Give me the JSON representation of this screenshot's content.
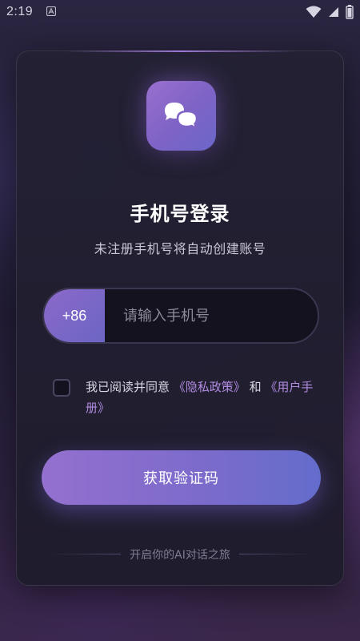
{
  "status_bar": {
    "time": "2:19",
    "icons": [
      "app-notification-icon",
      "wifi-icon",
      "signal-icon",
      "battery-icon"
    ]
  },
  "login": {
    "app_icon": "chat-bubbles-icon",
    "title": "手机号登录",
    "subtitle": "未注册手机号将自动创建账号",
    "phone": {
      "country_code": "+86",
      "value": "",
      "placeholder": "请输入手机号"
    },
    "agreement": {
      "checked": false,
      "prefix": "我已阅读并同意",
      "privacy_link": "《隐私政策》",
      "connector": "和",
      "manual_link": "《用户手册》"
    },
    "submit_label": "获取验证码",
    "footer": "开启你的AI对话之旅"
  },
  "colors": {
    "accent_start": "#9470cf",
    "accent_end": "#646ccb",
    "link": "#b08be0",
    "card_bg": "#242134"
  }
}
